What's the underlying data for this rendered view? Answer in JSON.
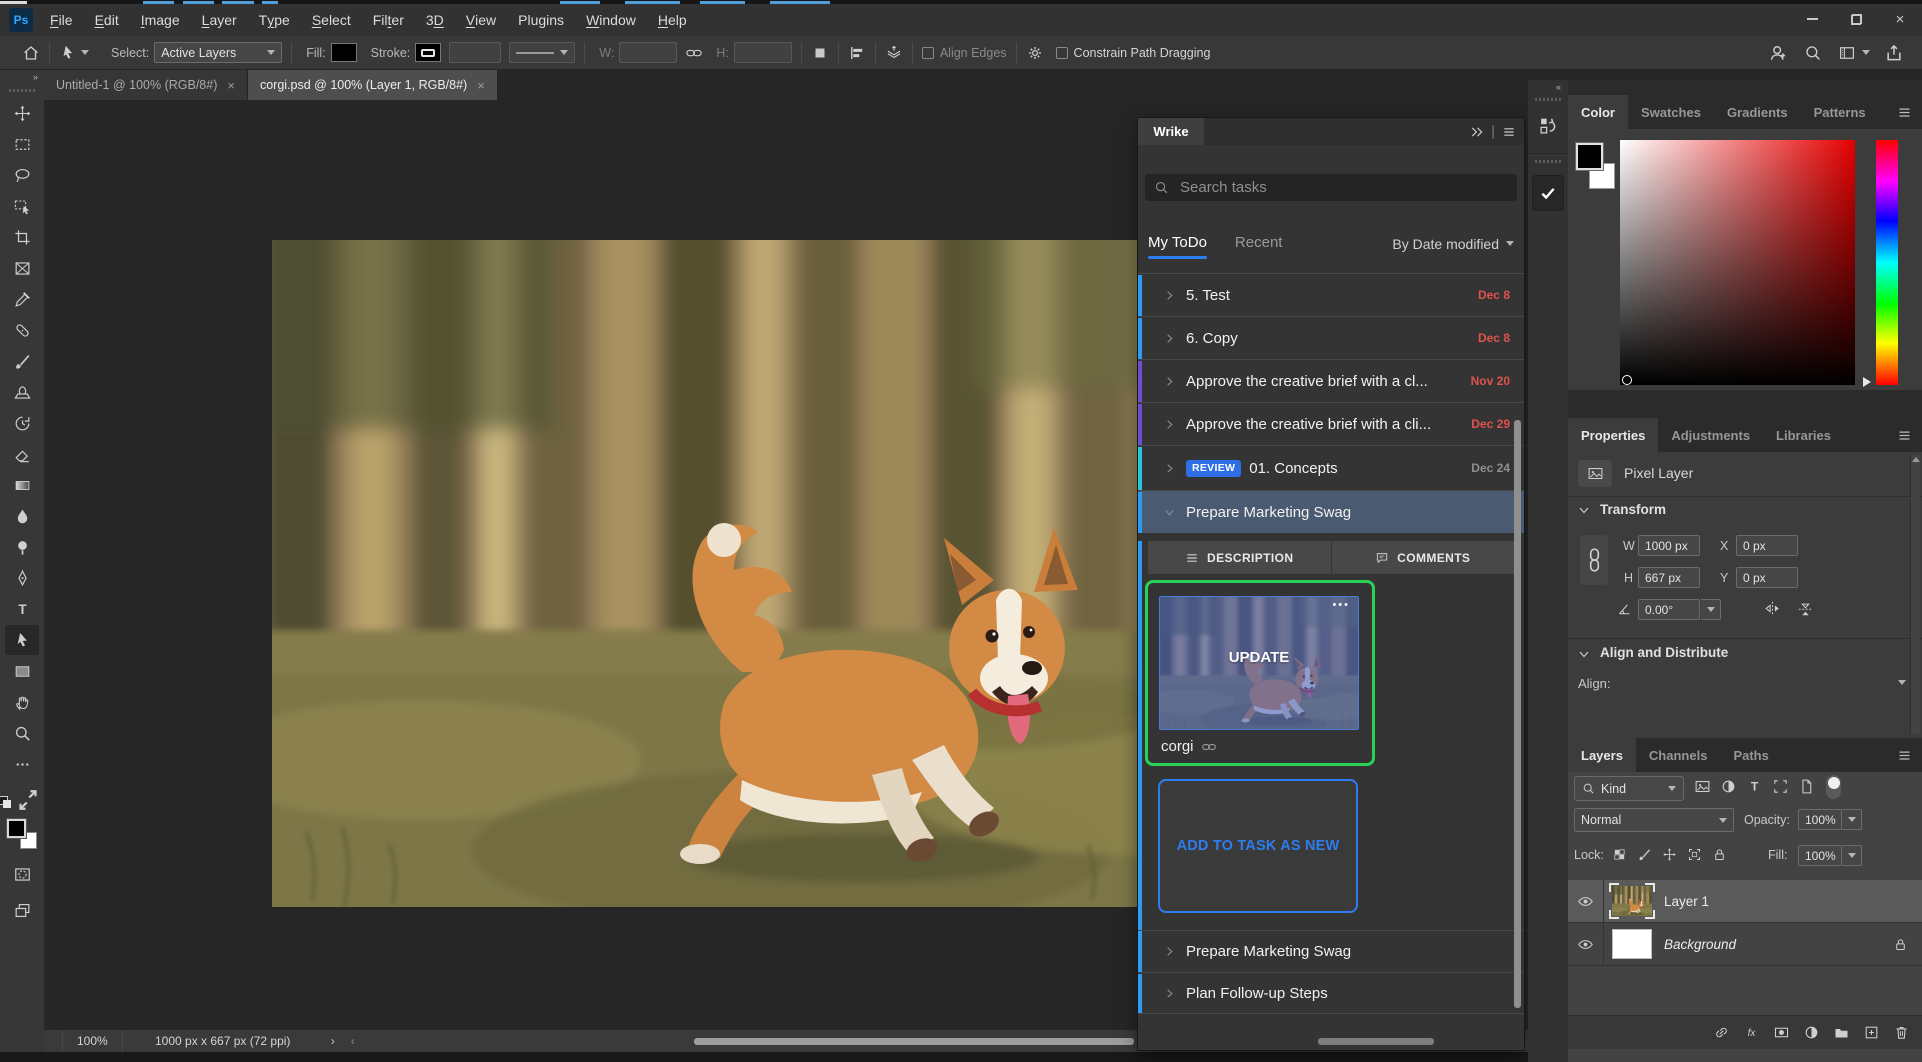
{
  "app": {
    "name": "Ps"
  },
  "menubar": {
    "items": [
      "File",
      "Edit",
      "Image",
      "Layer",
      "Type",
      "Select",
      "Filter",
      "3D",
      "View",
      "Plugins",
      "Window",
      "Help"
    ]
  },
  "options_bar": {
    "select_label": "Select:",
    "select_value": "Active Layers",
    "fill_label": "Fill:",
    "stroke_label": "Stroke:",
    "width_label": "W:",
    "height_label": "H:",
    "align_edges_label": "Align Edges",
    "constrain_label": "Constrain Path Dragging"
  },
  "document_tabs": [
    {
      "title": "Untitled-1 @ 100% (RGB/8#)",
      "close_glyph": "×"
    },
    {
      "title": "corgi.psd @ 100% (Layer 1, RGB/8#)",
      "close_glyph": "×"
    }
  ],
  "toolbar": {
    "tools": [
      "move",
      "rectangular-marquee",
      "lasso",
      "object-selection",
      "crop",
      "frame",
      "eyedropper",
      "spot-healing",
      "brush",
      "clone-stamp",
      "history-brush",
      "eraser",
      "gradient",
      "blur",
      "dodge",
      "pen",
      "type",
      "path-selection",
      "rectangle",
      "hand",
      "zoom",
      "more-tools"
    ],
    "selected_tool": "path-selection",
    "foreground_color": "#000000",
    "background_color": "#ffffff"
  },
  "wrike_panel": {
    "title": "Wrike",
    "search_placeholder": "Search tasks",
    "tab_my_todo": "My ToDo",
    "tab_recent": "Recent",
    "sort_label": "By Date modified",
    "tasks": [
      {
        "title": "5. Test",
        "due": "Dec 8",
        "due_color": "#e0524e",
        "stripe_color": "#2e9bf5"
      },
      {
        "title": "6. Copy",
        "due": "Dec 8",
        "due_color": "#e0524e",
        "stripe_color": "#2e9bf5"
      },
      {
        "title": "Approve the creative brief with a cl...",
        "due": "Nov 20",
        "due_color": "#e0524e",
        "stripe_color": "#6a4fd0"
      },
      {
        "title": "Approve the creative brief with a cli...",
        "due": "Dec 29",
        "due_color": "#e0524e",
        "stripe_color": "#6a4fd0"
      },
      {
        "title": "01. Concepts",
        "badge": "REVIEW",
        "badge_color": "#2e6fe8",
        "due": "Dec 24",
        "due_color": "#8f8f8f",
        "stripe_color": "#2bc7d4"
      }
    ],
    "selected_task": {
      "title": "Prepare Marketing Swag",
      "stripe_color": "#2e9bf5"
    },
    "detail_tabs": {
      "description": "DESCRIPTION",
      "comments": "COMMENTS"
    },
    "attachment": {
      "label": "UPDATE",
      "name": "corgi",
      "menu_glyph": "•••",
      "highlight_color": "#27d257"
    },
    "add_to_task_button": "ADD TO TASK AS NEW",
    "more_tasks": [
      {
        "title": "Prepare Marketing Swag",
        "stripe_color": "#2e9bf5"
      },
      {
        "title": "Plan Follow-up Steps",
        "stripe_color": "#2e9bf5"
      }
    ]
  },
  "color_panel": {
    "tabs": [
      "Color",
      "Swatches",
      "Gradients",
      "Patterns"
    ],
    "active_tab": "Color",
    "foreground_color": "#000000",
    "background_color": "#ffffff"
  },
  "properties_panel": {
    "tabs": [
      "Properties",
      "Adjustments",
      "Libraries"
    ],
    "active_tab": "Properties",
    "layer_type": "Pixel Layer",
    "transform": {
      "section_title": "Transform",
      "w_label": "W",
      "w_value": "1000 px",
      "x_label": "X",
      "x_value": "0 px",
      "h_label": "H",
      "h_value": "667 px",
      "y_label": "Y",
      "y_value": "0 px",
      "angle_value": "0.00°"
    },
    "align": {
      "section_title": "Align and Distribute",
      "align_label": "Align:"
    }
  },
  "layers_panel": {
    "tabs": [
      "Layers",
      "Channels",
      "Paths"
    ],
    "active_tab": "Layers",
    "kind_filter": "Kind",
    "filter_icons": [
      "image",
      "adjustment",
      "type",
      "frame-brackets",
      "smart-object"
    ],
    "blend_mode": "Normal",
    "opacity_label": "Opacity:",
    "opacity_value": "100%",
    "lock_label": "Lock:",
    "lock_icons": [
      "checkerboard",
      "brush",
      "move",
      "artboard",
      "lock"
    ],
    "fill_label": "Fill:",
    "fill_value": "100%",
    "layers": [
      {
        "name": "Layer 1",
        "selected": true
      },
      {
        "name": "Background",
        "locked": true
      }
    ],
    "bottom_icons": [
      "link",
      "fx",
      "layer-mask",
      "adjustment",
      "group-folder",
      "new-layer",
      "delete"
    ]
  },
  "status_bar": {
    "zoom_level": "100%",
    "doc_info": "1000 px x 667 px (72 ppi)"
  }
}
